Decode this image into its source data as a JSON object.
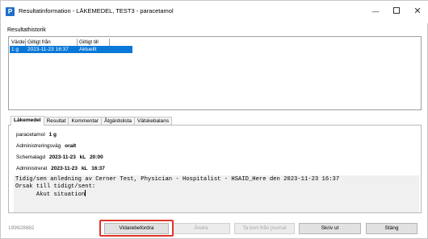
{
  "window": {
    "title": "Resultatinformation - LÄKEMEDEL, TEST3 - paracetamol",
    "app_icon_letter": "P",
    "minimize": "—",
    "close": "✕"
  },
  "history": {
    "label": "Resultathistorik",
    "columns": [
      "Värde",
      "Giltigt från",
      "Giltigt till"
    ],
    "rows": [
      {
        "value": "1 g",
        "valid_from": "2023-11-23 16:37",
        "valid_to": "Aktuellt"
      }
    ]
  },
  "tabs": [
    {
      "label": "Läkemedel",
      "active": true
    },
    {
      "label": "Resultat",
      "active": false
    },
    {
      "label": "Kommentar",
      "active": false
    },
    {
      "label": "Åtgärdslista",
      "active": false
    },
    {
      "label": "Vätskebalans",
      "active": false
    }
  ],
  "details": {
    "drug_name": "paracetamol",
    "drug_dose": "1 g",
    "route_label": "Administreringsväg",
    "route_value": "oralt",
    "scheduled_label": "Schemalagd",
    "scheduled_date": "2023-11-23",
    "scheduled_kl": "kL",
    "scheduled_time": "20:00",
    "administered_label": "Administrerat",
    "administered_date": "2023-11-23",
    "administered_kl": "kL",
    "administered_time": "16:37"
  },
  "comment": {
    "line1": "Tidig/sen anledning av Cerner Test, Physician - Hospitalist - HSAID_Here den 2023-11-23 16:37",
    "line2": "Orsak till tidigt/sent:",
    "line3": "      Akut situation"
  },
  "footer": {
    "id": "199928882",
    "buttons": {
      "forward": "Vidarebefordra",
      "change": "Ändra",
      "remove": "Ta bort från journal",
      "print": "Skriv ut",
      "close": "Stäng"
    }
  },
  "colors": {
    "selection": "#0a78d7",
    "app_icon": "#1f6fc6",
    "highlight": "#e0342c"
  }
}
